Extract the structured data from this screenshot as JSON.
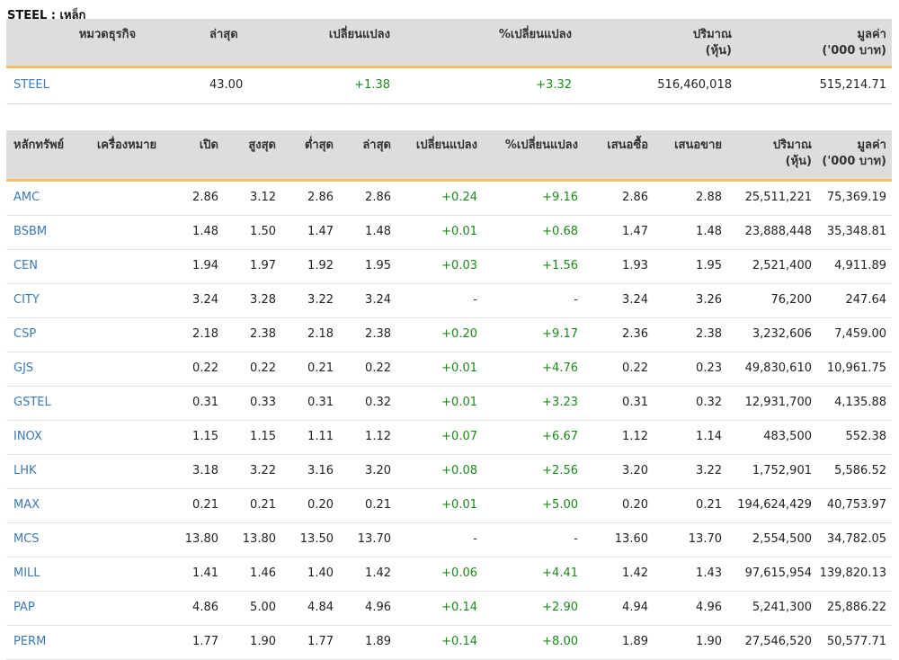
{
  "page_title": "STEEL : เหล็ก",
  "summary": {
    "headers": [
      "หมวดธุรกิจ",
      "ล่าสุด",
      "เปลี่ยนแปลง",
      "%เปลี่ยนแปลง",
      "ปริมาณ\n(หุ้น)",
      "มูลค่า\n('000 บาท)"
    ],
    "row": {
      "sector": "STEEL",
      "last": "43.00",
      "change": "+1.38",
      "pct_change": "+3.32",
      "volume": "516,460,018",
      "value": "515,214.71"
    }
  },
  "stocks": {
    "headers": [
      "หลักทรัพย์",
      "เครื่องหมาย",
      "เปิด",
      "สูงสุด",
      "ต่ำสุด",
      "ล่าสุด",
      "เปลี่ยนแปลง",
      "%เปลี่ยนแปลง",
      "เสนอซื้อ",
      "เสนอขาย",
      "ปริมาณ\n(หุ้น)",
      "มูลค่า\n('000 บาท)"
    ],
    "rows": [
      {
        "symbol": "AMC",
        "sign": "",
        "open": "2.86",
        "high": "3.12",
        "low": "2.86",
        "last": "2.86",
        "change": "+0.24",
        "pct": "+9.16",
        "bid": "2.86",
        "offer": "2.88",
        "volume": "25,511,221",
        "value": "75,369.19"
      },
      {
        "symbol": "BSBM",
        "sign": "",
        "open": "1.48",
        "high": "1.50",
        "low": "1.47",
        "last": "1.48",
        "change": "+0.01",
        "pct": "+0.68",
        "bid": "1.47",
        "offer": "1.48",
        "volume": "23,888,448",
        "value": "35,348.81"
      },
      {
        "symbol": "CEN",
        "sign": "",
        "open": "1.94",
        "high": "1.97",
        "low": "1.92",
        "last": "1.95",
        "change": "+0.03",
        "pct": "+1.56",
        "bid": "1.93",
        "offer": "1.95",
        "volume": "2,521,400",
        "value": "4,911.89"
      },
      {
        "symbol": "CITY",
        "sign": "",
        "open": "3.24",
        "high": "3.28",
        "low": "3.22",
        "last": "3.24",
        "change": "-",
        "pct": "-",
        "bid": "3.24",
        "offer": "3.26",
        "volume": "76,200",
        "value": "247.64"
      },
      {
        "symbol": "CSP",
        "sign": "",
        "open": "2.18",
        "high": "2.38",
        "low": "2.18",
        "last": "2.38",
        "change": "+0.20",
        "pct": "+9.17",
        "bid": "2.36",
        "offer": "2.38",
        "volume": "3,232,606",
        "value": "7,459.00"
      },
      {
        "symbol": "GJS",
        "sign": "",
        "open": "0.22",
        "high": "0.22",
        "low": "0.21",
        "last": "0.22",
        "change": "+0.01",
        "pct": "+4.76",
        "bid": "0.22",
        "offer": "0.23",
        "volume": "49,830,610",
        "value": "10,961.75"
      },
      {
        "symbol": "GSTEL",
        "sign": "",
        "open": "0.31",
        "high": "0.33",
        "low": "0.31",
        "last": "0.32",
        "change": "+0.01",
        "pct": "+3.23",
        "bid": "0.31",
        "offer": "0.32",
        "volume": "12,931,700",
        "value": "4,135.88"
      },
      {
        "symbol": "INOX",
        "sign": "",
        "open": "1.15",
        "high": "1.15",
        "low": "1.11",
        "last": "1.12",
        "change": "+0.07",
        "pct": "+6.67",
        "bid": "1.12",
        "offer": "1.14",
        "volume": "483,500",
        "value": "552.38"
      },
      {
        "symbol": "LHK",
        "sign": "",
        "open": "3.18",
        "high": "3.22",
        "low": "3.16",
        "last": "3.20",
        "change": "+0.08",
        "pct": "+2.56",
        "bid": "3.20",
        "offer": "3.22",
        "volume": "1,752,901",
        "value": "5,586.52"
      },
      {
        "symbol": "MAX",
        "sign": "",
        "open": "0.21",
        "high": "0.21",
        "low": "0.20",
        "last": "0.21",
        "change": "+0.01",
        "pct": "+5.00",
        "bid": "0.20",
        "offer": "0.21",
        "volume": "194,624,429",
        "value": "40,753.97"
      },
      {
        "symbol": "MCS",
        "sign": "",
        "open": "13.80",
        "high": "13.80",
        "low": "13.50",
        "last": "13.70",
        "change": "-",
        "pct": "-",
        "bid": "13.60",
        "offer": "13.70",
        "volume": "2,554,500",
        "value": "34,782.05"
      },
      {
        "symbol": "MILL",
        "sign": "",
        "open": "1.41",
        "high": "1.46",
        "low": "1.40",
        "last": "1.42",
        "change": "+0.06",
        "pct": "+4.41",
        "bid": "1.42",
        "offer": "1.43",
        "volume": "97,615,954",
        "value": "139,820.13"
      },
      {
        "symbol": "PAP",
        "sign": "",
        "open": "4.86",
        "high": "5.00",
        "low": "4.84",
        "last": "4.96",
        "change": "+0.14",
        "pct": "+2.90",
        "bid": "4.94",
        "offer": "4.96",
        "volume": "5,241,300",
        "value": "25,886.22"
      },
      {
        "symbol": "PERM",
        "sign": "",
        "open": "1.77",
        "high": "1.90",
        "low": "1.77",
        "last": "1.89",
        "change": "+0.14",
        "pct": "+8.00",
        "bid": "1.89",
        "offer": "1.90",
        "volume": "27,546,520",
        "value": "50,577.71"
      }
    ]
  },
  "colors": {
    "symbol_link": "#3a7ab5",
    "positive_change": "#1a8a1a",
    "header_bg": "#dddddd",
    "header_underline": "#f7c064"
  }
}
